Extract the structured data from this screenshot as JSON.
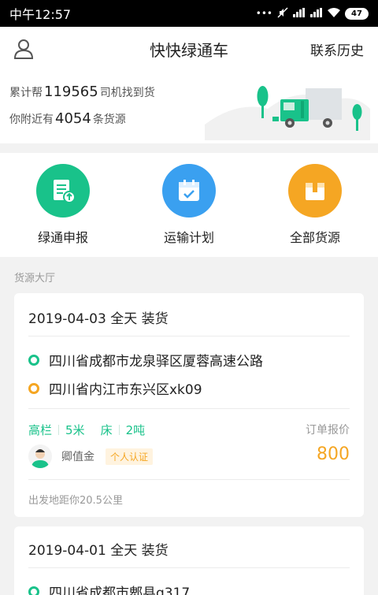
{
  "status_bar": {
    "time": "中午12:57",
    "battery": "47"
  },
  "header": {
    "title": "快快绿通车",
    "history_label": "联系历史"
  },
  "banner": {
    "line1_prefix": "累计帮",
    "line1_number": "119565",
    "line1_suffix": "司机找到货",
    "line2_prefix": "你附近有",
    "line2_number": "4054",
    "line2_suffix": "条货源"
  },
  "quick_actions": [
    {
      "label": "绿通申报",
      "color": "#19c28a",
      "icon": "document-upload-icon"
    },
    {
      "label": "运输计划",
      "color": "#3aa0f0",
      "icon": "calendar-check-icon"
    },
    {
      "label": "全部货源",
      "color": "#f5a623",
      "icon": "box-icon"
    }
  ],
  "section_title": "货源大厅",
  "listings": [
    {
      "date": "2019-04-03 全天 装货",
      "from": "四川省成都市龙泉驿区厦蓉高速公路",
      "to": "四川省内江市东兴区xk09",
      "specs": [
        "高栏",
        "5米",
        "床",
        "2吨"
      ],
      "price_label": "订单报价",
      "price": "800",
      "driver_name": "卿值金",
      "badge": "个人认证",
      "distance": "出发地距你20.5公里"
    },
    {
      "date": "2019-04-01 全天 装货",
      "from": "四川省成都市郫县g317"
    }
  ]
}
